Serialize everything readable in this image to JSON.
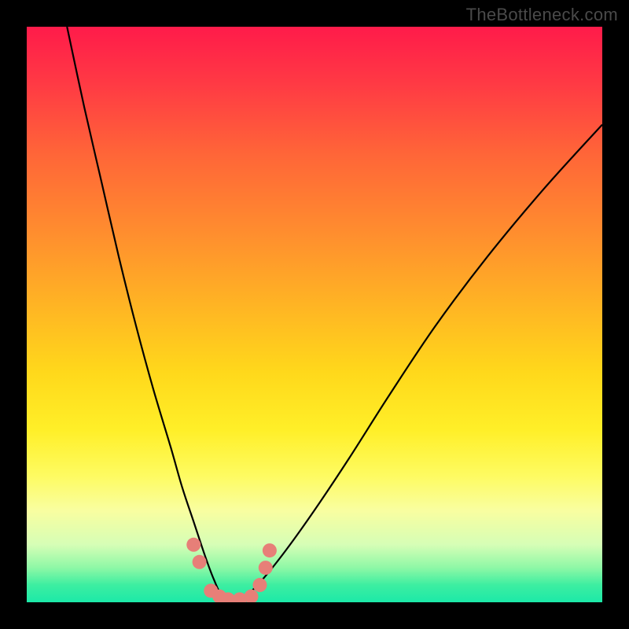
{
  "watermark": "TheBottleneck.com",
  "chart_data": {
    "type": "line",
    "title": "",
    "xlabel": "",
    "ylabel": "",
    "xlim": [
      0,
      100
    ],
    "ylim": [
      0,
      100
    ],
    "grid": false,
    "gradient_background": true,
    "series": [
      {
        "name": "bottleneck-curve",
        "x": [
          7,
          10,
          13,
          16,
          19,
          22,
          25,
          27,
          29,
          31,
          32.5,
          34,
          36,
          38,
          41,
          45,
          50,
          56,
          63,
          71,
          80,
          90,
          100
        ],
        "values": [
          100,
          86,
          73,
          60,
          48,
          37,
          27,
          20,
          14,
          8,
          4,
          1,
          0,
          1,
          4,
          9,
          16,
          25,
          36,
          48,
          60,
          72,
          83
        ]
      }
    ],
    "highlight_points": {
      "name": "optimal-range-markers",
      "color": "#e77f78",
      "x": [
        29,
        30,
        32,
        33.5,
        35,
        37,
        39,
        40.5,
        41.5,
        42.2
      ],
      "values": [
        10,
        7,
        2,
        1,
        0.5,
        0.5,
        1,
        3,
        6,
        9
      ]
    }
  }
}
